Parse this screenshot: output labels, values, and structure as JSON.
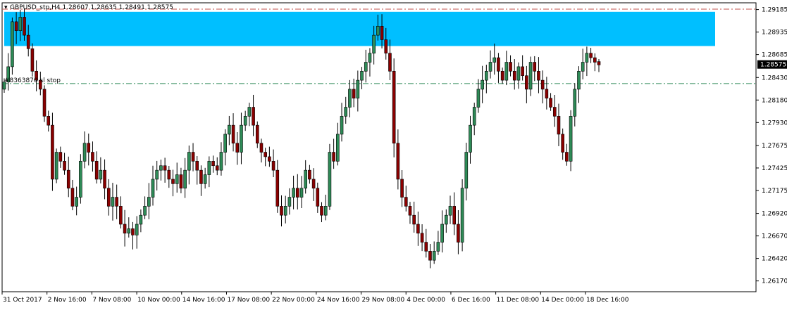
{
  "header": {
    "symbol_line": "GBPUSD_stp,H4  1.28607 1.28635 1.28491 1.28575",
    "order_label": "#8363870 sl stop"
  },
  "colors": {
    "bull": "#2e8b57",
    "bear": "#8b0000",
    "wick": "#000000",
    "zone": "#00bfff",
    "dashed_line": "#2e8b57",
    "top_dashed": "#c0504d"
  },
  "chart_data": {
    "type": "candlestick",
    "symbol": "GBPUSD_stp",
    "timeframe": "H4",
    "last_bar": {
      "open": 1.28607,
      "high": 1.28635,
      "low": 1.28491,
      "close": 1.28575
    },
    "current_price_label": "1.28575",
    "ylim": [
      1.2605,
      1.2926
    ],
    "y_ticks": [
      "1.29185",
      "1.28935",
      "1.28685",
      "1.28430",
      "1.28180",
      "1.27930",
      "1.27675",
      "1.27425",
      "1.27175",
      "1.26920",
      "1.26670",
      "1.26420",
      "1.26170"
    ],
    "x_ticks": [
      "31 Oct 2017",
      "2 Nov 16:00",
      "7 Nov 08:00",
      "10 Nov 00:00",
      "14 Nov 16:00",
      "17 Nov 08:00",
      "22 Nov 00:00",
      "24 Nov 16:00",
      "29 Nov 08:00",
      "4 Dec 00:00",
      "6 Dec 16:00",
      "11 Dec 08:00",
      "14 Dec 00:00",
      "18 Dec 16:00"
    ],
    "zone": {
      "from": 1.2878,
      "to": 1.2916
    },
    "horizontal_lines": [
      {
        "price": 1.28363,
        "style": "dash-dot",
        "label": "#8363870 sl stop"
      },
      {
        "price": 1.2919,
        "style": "dash-dot"
      }
    ],
    "closes": [
      1.2838,
      1.2855,
      1.2905,
      1.2895,
      1.291,
      1.289,
      1.2875,
      1.285,
      1.284,
      1.283,
      1.28,
      1.279,
      1.273,
      1.276,
      1.275,
      1.274,
      1.272,
      1.27,
      1.271,
      1.275,
      1.277,
      1.276,
      1.275,
      1.273,
      1.274,
      1.272,
      1.27,
      1.271,
      1.27,
      1.268,
      1.267,
      1.2675,
      1.2668,
      1.268,
      1.269,
      1.27,
      1.271,
      1.273,
      1.274,
      1.2745,
      1.274,
      1.273,
      1.2725,
      1.2735,
      1.272,
      1.274,
      1.276,
      1.275,
      1.274,
      1.2725,
      1.2735,
      1.275,
      1.2745,
      1.274,
      1.276,
      1.278,
      1.279,
      1.277,
      1.276,
      1.279,
      1.28,
      1.281,
      1.279,
      1.277,
      1.276,
      1.2755,
      1.275,
      1.274,
      1.27,
      1.269,
      1.27,
      1.271,
      1.272,
      1.271,
      1.272,
      1.274,
      1.273,
      1.272,
      1.27,
      1.269,
      1.27,
      1.276,
      1.275,
      1.278,
      1.28,
      1.281,
      1.283,
      1.282,
      1.284,
      1.285,
      1.286,
      1.287,
      1.289,
      1.29,
      1.2885,
      1.287,
      1.285,
      1.277,
      1.273,
      1.271,
      1.27,
      1.269,
      1.268,
      1.267,
      1.266,
      1.265,
      1.264,
      1.265,
      1.266,
      1.268,
      1.269,
      1.27,
      1.268,
      1.266,
      1.272,
      1.276,
      1.279,
      1.281,
      1.283,
      1.284,
      1.285,
      1.286,
      1.2865,
      1.285,
      1.284,
      1.286,
      1.285,
      1.284,
      1.2855,
      1.2845,
      1.283,
      1.286,
      1.285,
      1.284,
      1.283,
      1.282,
      1.281,
      1.28,
      1.278,
      1.276,
      1.275,
      1.28,
      1.283,
      1.285,
      1.286,
      1.287,
      1.2865,
      1.286,
      1.2857
    ]
  }
}
